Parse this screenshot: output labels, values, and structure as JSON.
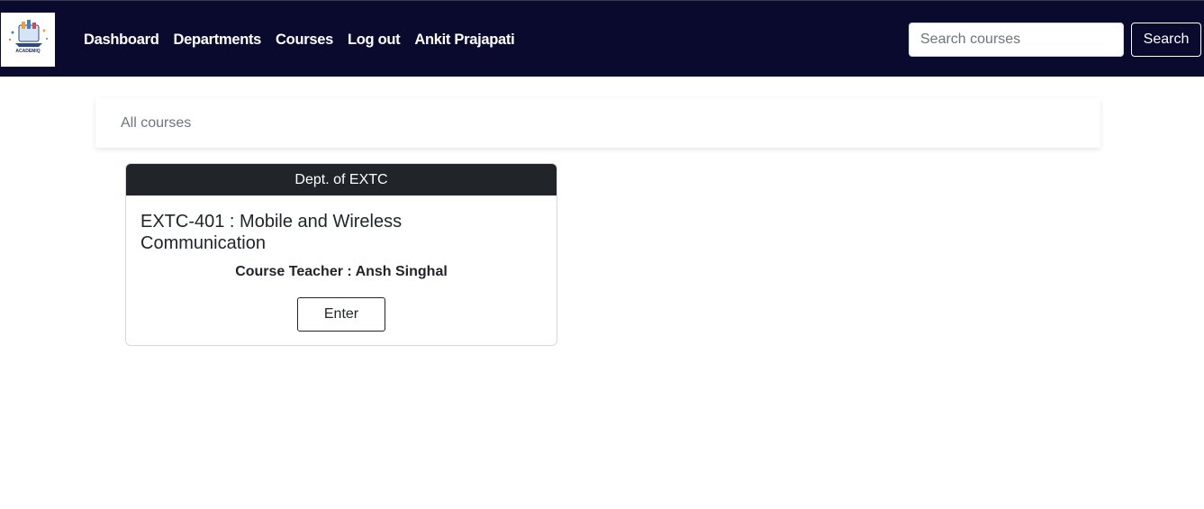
{
  "navbar": {
    "logo_alt": "ACADEMIQ",
    "links": [
      {
        "label": "Dashboard"
      },
      {
        "label": "Departments"
      },
      {
        "label": "Courses"
      },
      {
        "label": "Log out"
      },
      {
        "label": "Ankit Prajapati"
      }
    ],
    "search": {
      "placeholder": "Search courses",
      "value": "",
      "button_label": "Search"
    }
  },
  "breadcrumb": {
    "label": "All courses"
  },
  "courses": [
    {
      "department": "Dept. of EXTC",
      "title": "EXTC-401 : Mobile and Wireless Communication",
      "teacher": "Course Teacher : Ansh Singhal",
      "action_label": "Enter"
    }
  ],
  "colors": {
    "navbar_bg": "#0a0a2e",
    "card_header_bg": "#212529"
  }
}
